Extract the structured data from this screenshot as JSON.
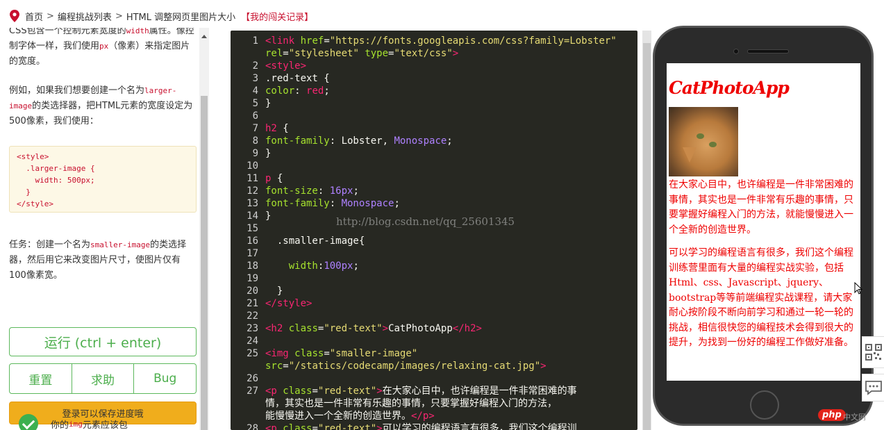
{
  "breadcrumb": {
    "home": "首页",
    "list": "编程挑战列表",
    "current": "HTML 调整网页里图片大小",
    "record": "【我的闯关记录】",
    "separator": ">"
  },
  "instructions": {
    "p1_a": "CSS包含一个控制元素宽度的",
    "p1_code1": "width",
    "p1_b": "属性。像控制字体一样，我们使用",
    "p1_code2": "px",
    "p1_c": "（像素）来指定图片的宽度。",
    "p2_a": "例如，如果我们想要创建一个名为",
    "p2_code": "larger-image",
    "p2_b": "的类选择器，把HTML元素的宽度设定为500像素，我们使用：",
    "example_lines": [
      "<style>",
      "  .larger-image {",
      "    width: 500px;",
      "  }",
      "</style>"
    ],
    "task_a": "任务：创建一个名为",
    "task_code": "smaller-image",
    "task_b": "的类选择器，然后用它来改变图片尺寸，使图片仅有100像素宽。"
  },
  "buttons": {
    "run": "运行 (ctrl + enter)",
    "reset": "重置",
    "help": "求助",
    "bug": "Bug",
    "login": "登录可以保存进度哦"
  },
  "test": {
    "text_a": "你的",
    "text_code": "img",
    "text_b": "元素应该包"
  },
  "editor": {
    "watermark": "http://blog.csdn.net/qq_25601345",
    "line_numbers": [
      "1",
      "",
      "2",
      "3",
      "4",
      "5",
      "6",
      "7",
      "8",
      "9",
      "10",
      "11",
      "12",
      "13",
      "14",
      "15",
      "16",
      "17",
      "18",
      "19",
      "20",
      "21",
      "22",
      "23",
      "24",
      "25",
      "",
      "26",
      "27",
      "",
      "",
      "28"
    ]
  },
  "preview": {
    "title": "CatPhotoApp",
    "para1": "在大家心目中，也许编程是一件非常困难的事情，其实也是一件非常有乐趣的事情，只要掌握好编程入门的方法，就能慢慢进入一个全新的创造世界。",
    "para2": "可以学习的编程语言有很多，我们这个编程训练营里面有大量的编程实战实验，包括Html、css、Javascript、jquery、bootstrap等等前端编程实战课程，请大家耐心按阶段不断向前学习和通过一轮一轮的挑战，相信很快您的编程技术会得到很大的提升，为找到一份好的编程工作做好准备。"
  },
  "footer": {
    "php_logo": "php",
    "php_suffix": "中文网"
  },
  "colors": {
    "accent_green": "#5cb85c",
    "login_orange": "#f0ad1c",
    "editor_bg": "#272822",
    "preview_red": "#ee0000",
    "inline_code_red": "#c8102e"
  },
  "icons": [
    "map-pin-icon",
    "check-circle-icon",
    "qr-code-icon",
    "chat-icon",
    "mouse-cursor-icon"
  ]
}
